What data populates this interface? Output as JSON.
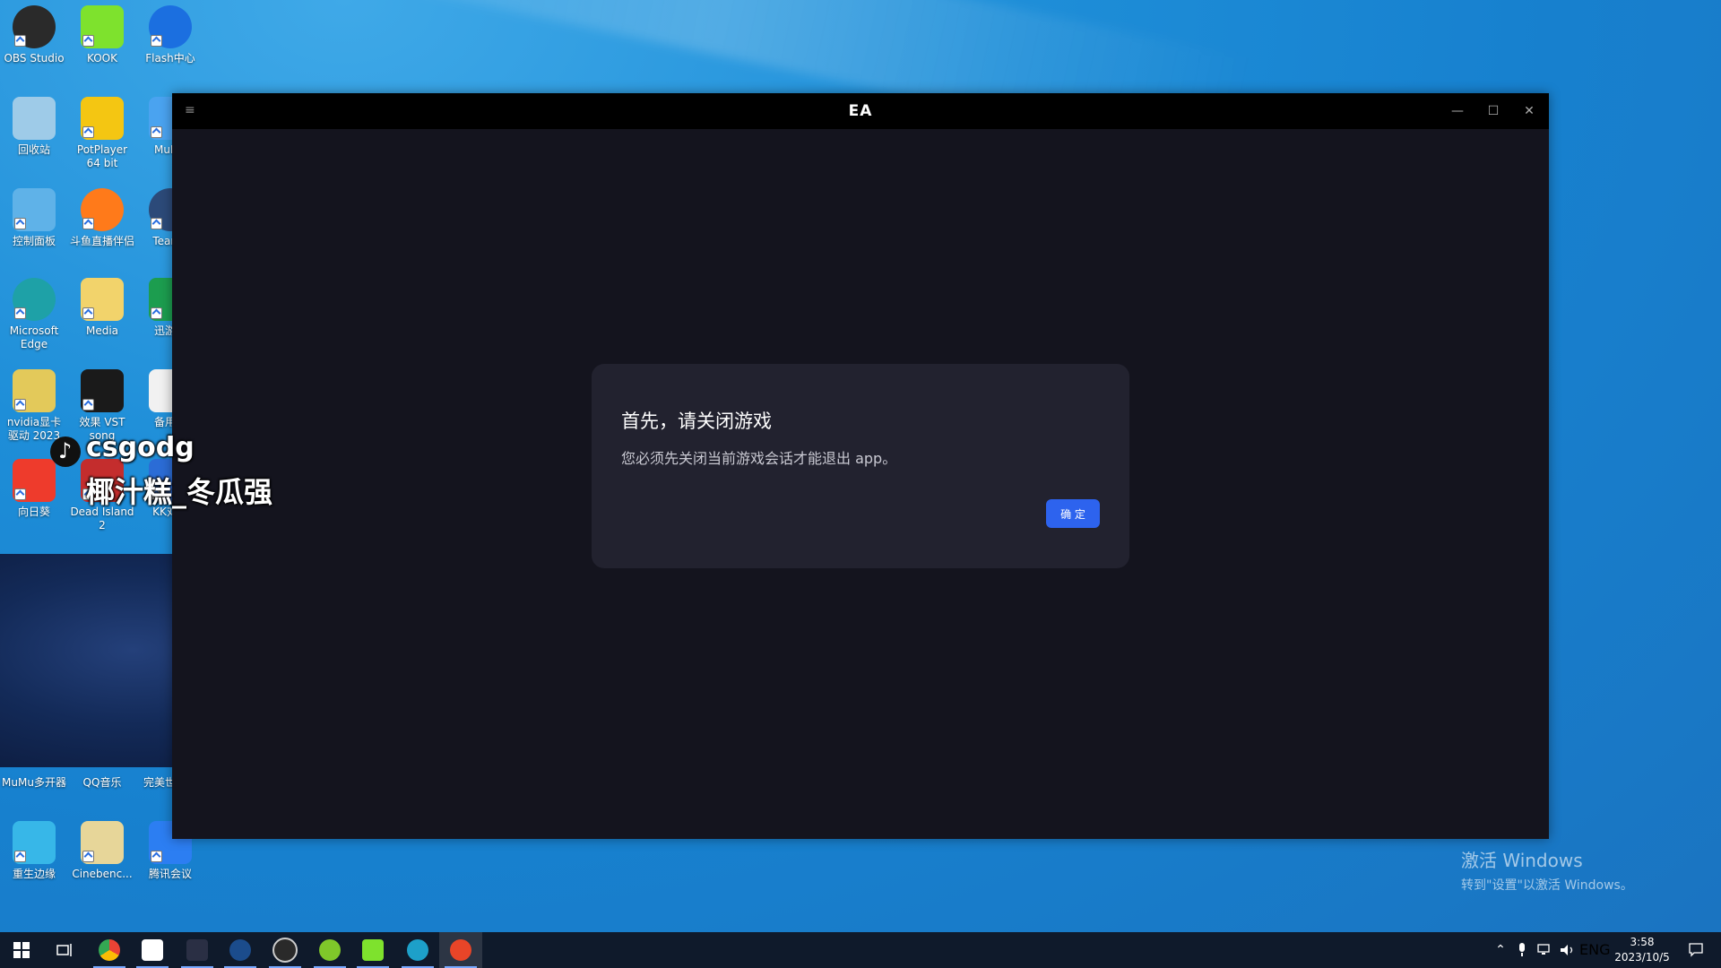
{
  "desktop": {
    "icons": [
      {
        "label": "OBS Studio",
        "color": "#2a2a2a"
      },
      {
        "label": "KOOK",
        "color": "#7ee22d"
      },
      {
        "label": "Flash中心",
        "color": "#1b6fe0"
      },
      {
        "label": "回收站",
        "color": "#9ecbe8"
      },
      {
        "label": "PotPlayer 64 bit",
        "color": "#f4c612"
      },
      {
        "label": "MuMu",
        "color": "#4aa3f0"
      },
      {
        "label": "控制面板",
        "color": "#5fb2e8"
      },
      {
        "label": "斗鱼直播伴侣",
        "color": "#ff7a1a"
      },
      {
        "label": "TeamS",
        "color": "#2c4a79"
      },
      {
        "label": "Microsoft Edge",
        "color": "#1ea1a7"
      },
      {
        "label": "Media",
        "color": "#f2d36b"
      },
      {
        "label": "迅游加",
        "color": "#1c9d4f"
      },
      {
        "label": "nvidia显卡驱动 2023",
        "color": "#e3c95a"
      },
      {
        "label": "效果 VST song",
        "color": "#1a1a1a"
      },
      {
        "label": "备用游",
        "color": "#f1f1f1"
      },
      {
        "label": "向日葵",
        "color": "#ee3b2c"
      },
      {
        "label": "Dead Island 2",
        "color": "#c42d2d"
      },
      {
        "label": "KK对战",
        "color": "#2b6cd6"
      },
      {
        "label": "MuMu多开器",
        "color": "#3b8ee6"
      },
      {
        "label": "QQ音乐",
        "color": "#f9d43a"
      },
      {
        "label": "完美世界平",
        "color": "#d42c2c"
      },
      {
        "label": "重生边缘",
        "color": "#37b7e8"
      },
      {
        "label": "Cinebenc...",
        "color": "#e7d699"
      },
      {
        "label": "腾讯会议",
        "color": "#2c7ef2"
      }
    ]
  },
  "overlay": {
    "tiktok_user": "csgodg",
    "tiktok_sub": "椰汁糕_冬瓜强"
  },
  "ea_window": {
    "title": "EA",
    "menu_icon": "≡",
    "minimize": "—",
    "maximize": "☐",
    "close": "✕",
    "dialog": {
      "title": "首先，请关闭游戏",
      "message": "您必须先关闭当前游戏会话才能退出 app。",
      "ok_label": "确 定"
    }
  },
  "watermark": {
    "title": "激活 Windows",
    "subtitle": "转到\"设置\"以激活 Windows。"
  },
  "taskbar": {
    "apps": [
      {
        "name": "start-icon",
        "color": "#ffffff"
      },
      {
        "name": "task-view-icon",
        "color": "#ffffff"
      },
      {
        "name": "chrome-icon",
        "color": "#e84c3d"
      },
      {
        "name": "app-vst-icon",
        "color": "#ffffff"
      },
      {
        "name": "app-se-icon",
        "color": "#2a2f44"
      },
      {
        "name": "steam-icon",
        "color": "#1b4c8c"
      },
      {
        "name": "obs-icon",
        "color": "#2a2a2a"
      },
      {
        "name": "app-green-icon",
        "color": "#7fc72a"
      },
      {
        "name": "kook-icon",
        "color": "#7ee22d"
      },
      {
        "name": "app-teal-icon",
        "color": "#1da0c9"
      },
      {
        "name": "ea-icon",
        "color": "#e84528"
      }
    ],
    "tray": {
      "language": "ENG",
      "time": "3:58",
      "date": "2023/10/5"
    }
  }
}
